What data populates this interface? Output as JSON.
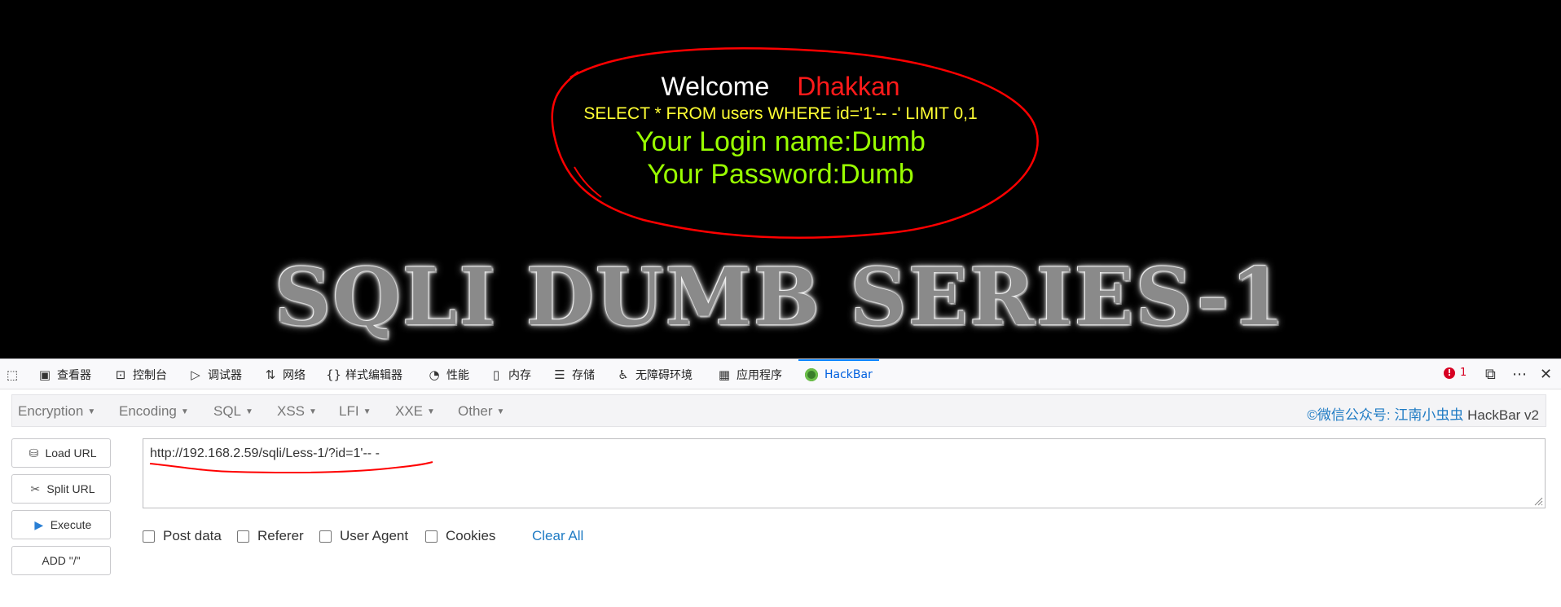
{
  "page": {
    "welcome_label": "Welcome",
    "welcome_name": "Dhakkan",
    "query": "SELECT * FROM users WHERE id='1'-- -' LIMIT 0,1",
    "login_line": "Your Login name:Dumb",
    "password_line": "Your Password:Dumb",
    "banner": "SQLI DUMB SERIES-1"
  },
  "devtools": {
    "tabs": [
      {
        "label": "查看器",
        "icon": "inspector-icon"
      },
      {
        "label": "控制台",
        "icon": "console-icon"
      },
      {
        "label": "调试器",
        "icon": "debugger-icon"
      },
      {
        "label": "网络",
        "icon": "network-icon"
      },
      {
        "label": "样式编辑器",
        "icon": "style-editor-icon"
      },
      {
        "label": "性能",
        "icon": "performance-icon"
      },
      {
        "label": "内存",
        "icon": "memory-icon"
      },
      {
        "label": "存储",
        "icon": "storage-icon"
      },
      {
        "label": "无障碍环境",
        "icon": "accessibility-icon"
      },
      {
        "label": "应用程序",
        "icon": "application-icon"
      },
      {
        "label": "HackBar",
        "icon": "hackbar-icon"
      }
    ],
    "active_tab": "HackBar",
    "error_count": "1"
  },
  "hackbar": {
    "menus": [
      "Encryption",
      "Encoding",
      "SQL",
      "XSS",
      "LFI",
      "XXE",
      "Other"
    ],
    "credit_cn": "©微信公众号: 江南小虫虫",
    "credit_en": "HackBar v2",
    "buttons": {
      "load_url": "Load URL",
      "split_url": "Split URL",
      "execute": "Execute",
      "add_slash": "ADD \"/\""
    },
    "url": "http://192.168.2.59/sqli/Less-1/?id=1'-- -",
    "options": [
      "Post data",
      "Referer",
      "User Agent",
      "Cookies"
    ],
    "clear_all": "Clear All"
  },
  "colors": {
    "accent_blue": "#0a84ff",
    "query_yellow": "#ffff33",
    "result_green": "#99ff00",
    "name_red": "#ff1a1a",
    "annotation_red": "#ff0000"
  }
}
